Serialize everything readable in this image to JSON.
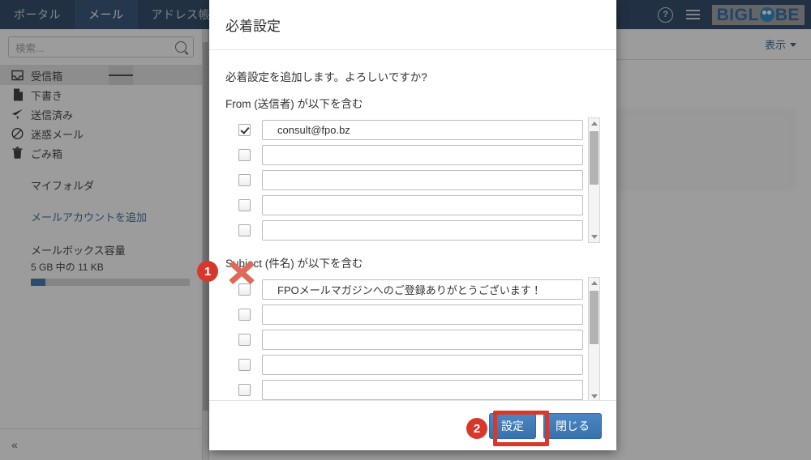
{
  "topnav": {
    "tabs": [
      {
        "label": "ポータル",
        "active": false
      },
      {
        "label": "メール",
        "active": true
      },
      {
        "label": "アドレス帳",
        "active": false
      }
    ],
    "help_icon": "?",
    "menu_icon": "hamburger-icon",
    "brand": {
      "part1": "BIGL",
      "part2": "BE"
    }
  },
  "sidebar": {
    "search": {
      "placeholder": "検索...",
      "value": ""
    },
    "folders": [
      {
        "label": "受信箱",
        "icon": "inbox-icon",
        "selected": true,
        "has_menu": true
      },
      {
        "label": "下書き",
        "icon": "draft-file-icon",
        "selected": false,
        "has_menu": false
      },
      {
        "label": "送信済み",
        "icon": "paper-plane-icon",
        "selected": false,
        "has_menu": false
      },
      {
        "label": "迷惑メール",
        "icon": "ban-icon",
        "selected": false,
        "has_menu": false
      },
      {
        "label": "ごみ箱",
        "icon": "trash-icon",
        "selected": false,
        "has_menu": false
      }
    ],
    "myfolder_label": "マイフォルダ",
    "add_account_label": "メールアカウントを追加",
    "capacity": {
      "title": "メールボックス容量",
      "usage": "5 GB 中の 11 KB",
      "percent": 9
    },
    "collapse_icon": "«"
  },
  "right_pane": {
    "display_label": "表示",
    "caret_icon": "chevron-down-icon"
  },
  "modal": {
    "title": "必着設定",
    "lead": "必着設定を追加します。よろしいですか?",
    "from_label": "From (送信者) が以下を含む",
    "from_rows": [
      {
        "checked": true,
        "value": "consult@fpo.bz"
      },
      {
        "checked": false,
        "value": ""
      },
      {
        "checked": false,
        "value": ""
      },
      {
        "checked": false,
        "value": ""
      },
      {
        "checked": false,
        "value": ""
      }
    ],
    "subject_label": "Subject (件名) が以下を含む",
    "subject_rows": [
      {
        "checked": false,
        "value": "FPOメールマガジンへのご登録ありがとうございます！"
      },
      {
        "checked": false,
        "value": ""
      },
      {
        "checked": false,
        "value": ""
      },
      {
        "checked": false,
        "value": ""
      },
      {
        "checked": false,
        "value": ""
      }
    ],
    "buttons": {
      "submit": "設定",
      "close": "閉じる"
    }
  },
  "annotations": {
    "step1": "1",
    "step2": "2",
    "x_marker": "x-cross-marker",
    "highlight_box": "red-highlight-box"
  },
  "colors": {
    "nav_bg": "#1d3a5c",
    "accent_blue": "#3a71ab",
    "annotation_red": "#d8382b",
    "link_blue": "#2a6496",
    "brand_blue": "#1a5fa8"
  }
}
